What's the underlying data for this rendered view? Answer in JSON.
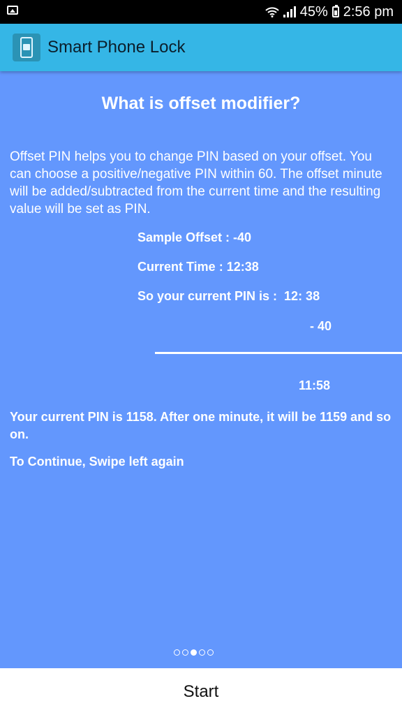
{
  "status_bar": {
    "battery": "45%",
    "time": "2:56 pm"
  },
  "app_bar": {
    "title": "Smart Phone Lock",
    "icon": "phone-lock-icon"
  },
  "content": {
    "heading": "What is offset modifier?",
    "intro": "Offset PIN helps you to change PIN based on your offset. You can choose a positive/negative PIN within 60. The offset minute will be added/subtracted from the current time and the resulting value will be set as PIN.",
    "sample_offset": "Sample Offset : -40",
    "current_time": "Current Time : 12:38",
    "current_pin_label": "So your current PIN is :  12: 38",
    "minus_offset": "- 40",
    "result": "11:58",
    "explanation": "Your current PIN is 1158. After one minute, it will be 1159 and so on.",
    "continue_hint": "To Continue, Swipe left again",
    "page_indicator": {
      "total": 5,
      "active": 3
    }
  },
  "bottom": {
    "start_label": "Start"
  },
  "colors": {
    "app_bar": "#35b6e6",
    "content_bg": "#6397fd"
  }
}
